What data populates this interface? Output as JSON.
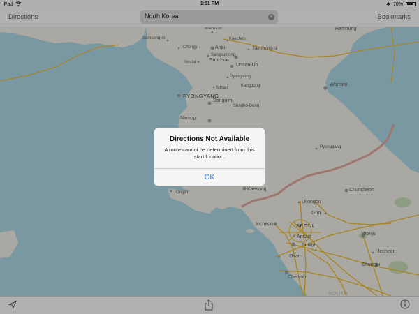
{
  "status_bar": {
    "time": "1:51 PM",
    "battery": "70%"
  },
  "nav_bar": {
    "directions_label": "Directions",
    "bookmarks_label": "Bookmarks",
    "search": {
      "value": "North Korea",
      "placeholder": ""
    }
  },
  "map": {
    "labels": {
      "hamhung": "Hamhung",
      "teachon": "Teach On",
      "kaechon": "Kaechon",
      "samsong": "Samsong-ni",
      "chongju": "Chongju",
      "anju": "Anju",
      "sangsuktong": "Sangsuktong",
      "taepyongni": "Taep'Yong-Ni",
      "sinni": "Sin-Ni",
      "sunchon": "Sunchon",
      "unsanup": "Unsan-Up",
      "pyongsong": "Pyongsong",
      "wonsan": "Wonsan",
      "sunan": "Sunan",
      "kangdong": "Kangdong",
      "pyongyang": "PYONGYANG",
      "sunghodong": "Sungho-Dong",
      "nampo": "Nampo",
      "songnim": "Songnim",
      "pyonggang": "Pyonggang",
      "ongjin": "Ongjin",
      "kaesong": "Kaesong",
      "chuncheon": "Chuncheon",
      "uijongbu": "Uijongbu",
      "guri": "Guri",
      "incheon": "Incheon",
      "seoul": "SEOUL",
      "wonju": "Wonju",
      "ansan": "Ansan",
      "suwon": "Suwon",
      "jecheon": "Jecheon",
      "osan": "Osan",
      "chungju": "Chungju",
      "cheonan": "Cheonan",
      "south": "SOUTH"
    }
  },
  "alert": {
    "title": "Directions Not Available",
    "message": "A route cannot be determined from this start location.",
    "ok_label": "OK"
  },
  "colors": {
    "water": "#aad3df",
    "land": "#ece9e1",
    "accent": "#1a74f0",
    "road": "#e9b62a"
  }
}
